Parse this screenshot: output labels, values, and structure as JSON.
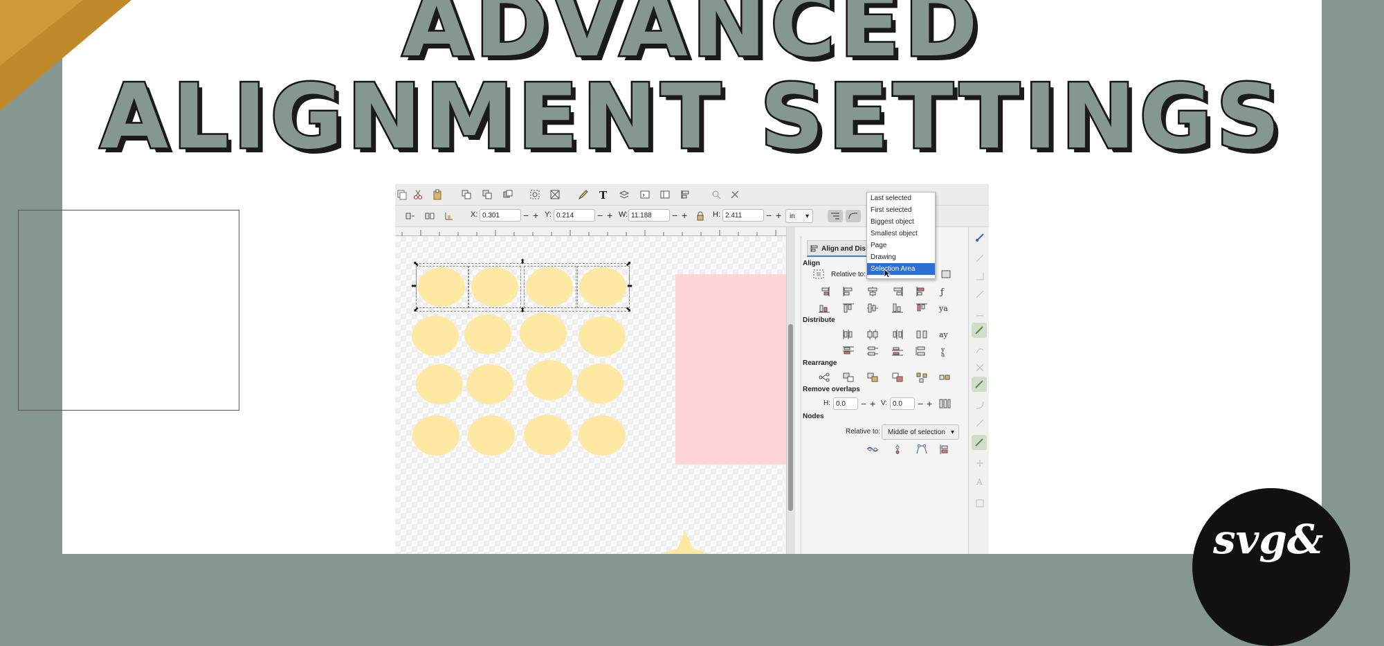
{
  "headline": {
    "line1": "ADVANCED",
    "line2": "ALIGNMENT SETTINGS"
  },
  "logo": {
    "text": "svg&"
  },
  "colors": {
    "background": "#869693",
    "accent_gold": "#c08a2a",
    "ellipse_fill": "#fde9a4",
    "pink_rect": "#ffd6d8",
    "selection_blue": "#2f6fd1"
  },
  "app": {
    "toolbar_icons": [
      "copy-icon",
      "cut-icon",
      "paste-icon",
      "group-icon",
      "ungroup-icon",
      "raise-icon",
      "zoom-fit-icon",
      "zoom-selection-icon",
      "pencil-icon",
      "text-tool-icon",
      "layers-icon",
      "xml-editor-icon",
      "objects-icon",
      "align-icon",
      "search-icon",
      "preferences-icon"
    ],
    "coords": {
      "x_label": "X:",
      "x_value": "0.301",
      "y_label": "Y:",
      "y_value": "0.214",
      "w_label": "W:",
      "w_value": "11.188",
      "h_label": "H:",
      "h_value": "2.411",
      "unit": "in"
    },
    "dock": {
      "tab_label": "Align and Dis",
      "align_heading": "Align",
      "relative_to_label": "Relative to:",
      "distribute_heading": "Distribute",
      "rearrange_heading": "Rearrange",
      "remove_overlaps_heading": "Remove overlaps",
      "h_label": "H:",
      "h_value": "0.0",
      "v_label": "V:",
      "v_value": "0.0",
      "nodes_heading": "Nodes",
      "nodes_relative_label": "Relative to:",
      "nodes_relative_value": "Middle of selection"
    },
    "dropdown": {
      "options": [
        "Last selected",
        "First selected",
        "Biggest object",
        "Smallest object",
        "Page",
        "Drawing",
        "Selection Area"
      ],
      "selected": "Selection Area"
    }
  }
}
